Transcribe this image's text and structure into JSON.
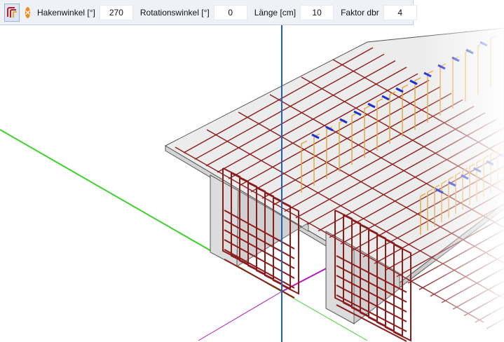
{
  "toolbar": {
    "tool_icon": "rebar-hook-icon",
    "close_icon": "close-icon",
    "close_glyph": "×",
    "fields": [
      {
        "label": "Hakenwinkel [°]",
        "value": "270"
      },
      {
        "label": "Rotationswinkel [°]",
        "value": "0"
      },
      {
        "label": "Länge [cm]",
        "value": "10"
      },
      {
        "label": "Faktor dbr",
        "value": "4"
      }
    ]
  },
  "colors": {
    "axis_x": "#3cd12c",
    "axis_y": "#1c5fc7",
    "axis_z": "#b41ab4",
    "rebar": "#8b1c1c",
    "stirrup_hook": "#e3a43a",
    "spacer": "#1c2fd0",
    "concrete": "#e8e8e8",
    "concrete_side": "#cfcfcf",
    "accent": "#f08a1c"
  }
}
